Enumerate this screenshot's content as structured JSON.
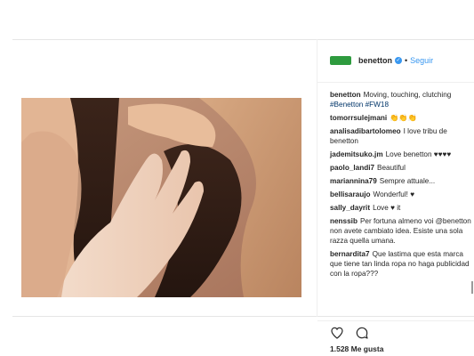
{
  "post": {
    "username": "benetton",
    "follow_label": "Seguir",
    "dot": "•",
    "verified_glyph": "✓",
    "likes_label": "1.528 Me gusta",
    "brand_color": "#2e9b3e",
    "link_color": "#3897f0",
    "photo_alt": "Hands of different skin tones touching"
  },
  "comments": [
    {
      "user": "benetton",
      "text": "Moving, touching, clutching",
      "tags": "#Benetton #FW18"
    },
    {
      "user": "tomorrsulejmani",
      "text": "👏👏👏",
      "tags": ""
    },
    {
      "user": "analisadibartolomeo",
      "text": "I love tribu de benetton",
      "tags": ""
    },
    {
      "user": "jademitsuko.jm",
      "text": "Love benetton ♥♥♥♥",
      "tags": ""
    },
    {
      "user": "paolo_landi7",
      "text": "Beautiful",
      "tags": ""
    },
    {
      "user": "mariannina79",
      "text": "Sempre attuale...",
      "tags": ""
    },
    {
      "user": "bellisaraujo",
      "text": "Wonderful! ♥",
      "tags": ""
    },
    {
      "user": "sally_dayrit",
      "text": "Love ♥ it",
      "tags": ""
    },
    {
      "user": "nenssib",
      "text": "Per fortuna almeno voi @benetton non avete cambiato idea. Esiste una sola razza quella umana.",
      "tags": ""
    },
    {
      "user": "bernardita7",
      "text": "Que lastima que esta marca que tiene tan linda ropa no haga publicidad con la ropa???",
      "tags": ""
    }
  ],
  "icons": {
    "like": "heart-icon",
    "comment": "comment-bubble-icon"
  }
}
